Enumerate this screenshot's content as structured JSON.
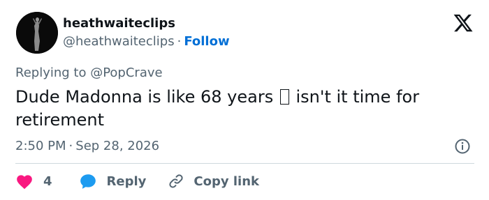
{
  "author": {
    "display_name": "heathwaiteclips",
    "handle": "@heathwaiteclips",
    "separator": "·",
    "follow_label": "Follow",
    "avatar_icon": "avatar-photo"
  },
  "brand": {
    "logo_icon": "x-logo-icon",
    "color": "#0f1419"
  },
  "tweet": {
    "replying_to": "Replying to @PopCrave",
    "text_before": "Dude Madonna is like 68 years",
    "text_after": "isn't it time for retirement",
    "time": "2:50 PM",
    "separator": "·",
    "date": "Sep 28, 2026"
  },
  "actions": {
    "like_count": "4",
    "reply_label": "Reply",
    "copy_link_label": "Copy link"
  },
  "colors": {
    "like": "#f91880",
    "reply": "#1d9bf0",
    "follow": "#006fd6",
    "secondary_text": "#536471",
    "divider": "#cfd9de"
  }
}
